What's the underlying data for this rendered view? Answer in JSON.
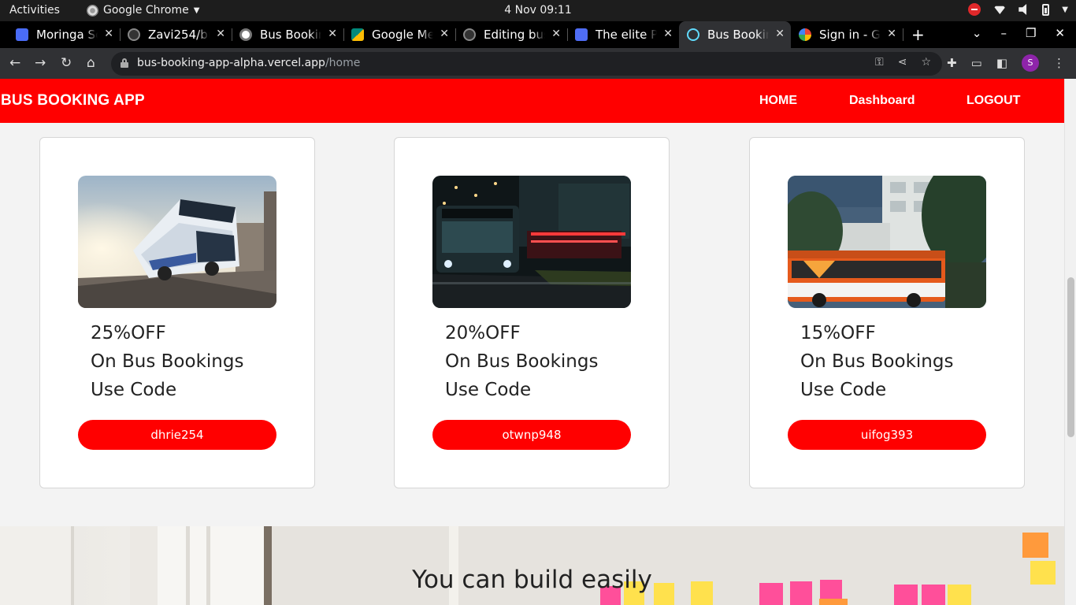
{
  "os": {
    "activities": "Activities",
    "app_name": "Google Chrome",
    "clock": "4 Nov  09:11"
  },
  "tabs": [
    {
      "title": "Moringa Sc",
      "favicon_color": "#4a6cf7"
    },
    {
      "title": "Zavi254/bu",
      "favicon_color": "#333333"
    },
    {
      "title": "Bus Bookin",
      "favicon_color": "#dddddd"
    },
    {
      "title": "Google Mee",
      "favicon_color": "#00897b"
    },
    {
      "title": "Editing bus",
      "favicon_color": "#333333"
    },
    {
      "title": "The elite Pr",
      "favicon_color": "#4f6df5"
    },
    {
      "title": "Bus Bookin",
      "favicon_color": "#61dafb",
      "active": true
    },
    {
      "title": "Sign in - Go",
      "favicon_color": "#ea4335"
    }
  ],
  "address_bar": {
    "host": "bus-booking-app-alpha.vercel.app",
    "path": "/home"
  },
  "profile_initial": "S",
  "app": {
    "brand": "BUS BOOKING APP",
    "nav": {
      "home": "HOME",
      "dashboard": "Dashboard",
      "logout": "LOGOUT"
    },
    "accent_color": "#ff0000"
  },
  "offers": [
    {
      "discount": "25%OFF",
      "line2": "On Bus Bookings",
      "line3": "Use Code",
      "code": "dhrie254",
      "image": "coach bus on sunlit road"
    },
    {
      "discount": "20%OFF",
      "line2": "On Bus Bookings",
      "line3": "Use Code",
      "code": "otwnp948",
      "image": "city bus at night"
    },
    {
      "discount": "15%OFF",
      "line2": "On Bus Bookings",
      "line3": "Use Code",
      "code": "uifog393",
      "image": "orange bus by trees"
    }
  ],
  "hero": {
    "heading": "You can build easily"
  }
}
